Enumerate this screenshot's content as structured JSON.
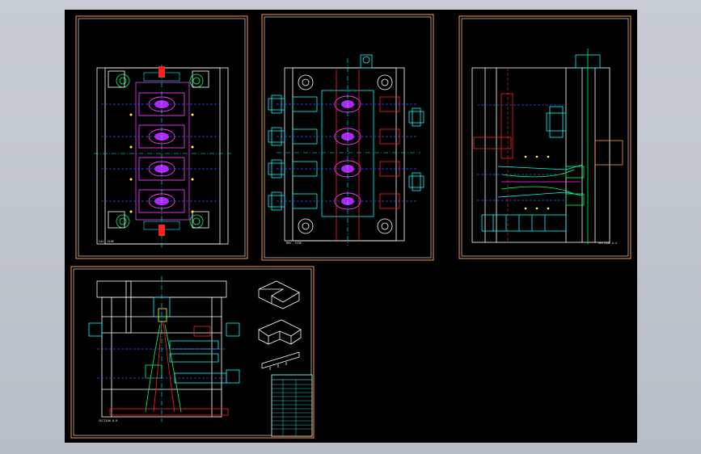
{
  "drawing": {
    "background": "#000000",
    "frame_color": "#ff9933",
    "sheets": [
      {
        "id": "sheet-1",
        "view": "top-plan-view",
        "label": "CAV. SIDE",
        "cavities": 4
      },
      {
        "id": "sheet-2",
        "view": "core-side-view",
        "label": "MOV. SIDE",
        "cavities": 4
      },
      {
        "id": "sheet-3",
        "view": "side-section-view",
        "label": "SECTION A-A"
      },
      {
        "id": "sheet-4",
        "view": "front-section-view",
        "label": "SECTION B-B"
      }
    ],
    "part_views": [
      "part-isometric-view-1",
      "part-isometric-view-2",
      "part-profile-view"
    ],
    "title_block": {
      "rows": 14,
      "header_color": "#33ffff"
    }
  },
  "colors": {
    "white": "#ffffff",
    "cyan": "#00ffff",
    "magenta": "#ff33ff",
    "green": "#00ff66",
    "red": "#ff2222",
    "yellow": "#ffff33",
    "blue": "#3355ff",
    "orange": "#ff9933"
  }
}
